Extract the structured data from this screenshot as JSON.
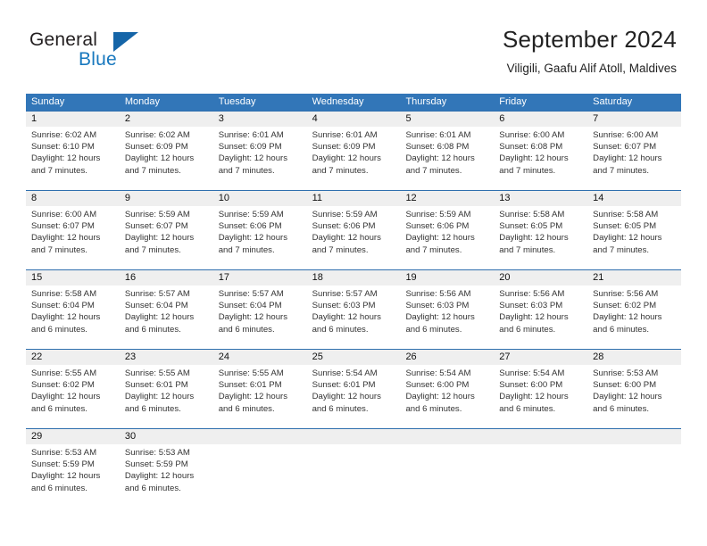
{
  "brand": {
    "name_part1": "General",
    "name_part2": "Blue",
    "logo_icon": "triangle-logo-icon",
    "accent_color": "#1565a8"
  },
  "header": {
    "title": "September 2024",
    "location": "Viligili, Gaafu Alif Atoll, Maldives"
  },
  "theme": {
    "header_band_color": "#3276b8",
    "row_rule_color": "#2f6fae",
    "day_strip_color": "#efefef",
    "text_color": "#333333"
  },
  "weekdays": [
    "Sunday",
    "Monday",
    "Tuesday",
    "Wednesday",
    "Thursday",
    "Friday",
    "Saturday"
  ],
  "weeks": [
    [
      {
        "day": "1",
        "sunrise": "Sunrise: 6:02 AM",
        "sunset": "Sunset: 6:10 PM",
        "daylight1": "Daylight: 12 hours",
        "daylight2": "and 7 minutes."
      },
      {
        "day": "2",
        "sunrise": "Sunrise: 6:02 AM",
        "sunset": "Sunset: 6:09 PM",
        "daylight1": "Daylight: 12 hours",
        "daylight2": "and 7 minutes."
      },
      {
        "day": "3",
        "sunrise": "Sunrise: 6:01 AM",
        "sunset": "Sunset: 6:09 PM",
        "daylight1": "Daylight: 12 hours",
        "daylight2": "and 7 minutes."
      },
      {
        "day": "4",
        "sunrise": "Sunrise: 6:01 AM",
        "sunset": "Sunset: 6:09 PM",
        "daylight1": "Daylight: 12 hours",
        "daylight2": "and 7 minutes."
      },
      {
        "day": "5",
        "sunrise": "Sunrise: 6:01 AM",
        "sunset": "Sunset: 6:08 PM",
        "daylight1": "Daylight: 12 hours",
        "daylight2": "and 7 minutes."
      },
      {
        "day": "6",
        "sunrise": "Sunrise: 6:00 AM",
        "sunset": "Sunset: 6:08 PM",
        "daylight1": "Daylight: 12 hours",
        "daylight2": "and 7 minutes."
      },
      {
        "day": "7",
        "sunrise": "Sunrise: 6:00 AM",
        "sunset": "Sunset: 6:07 PM",
        "daylight1": "Daylight: 12 hours",
        "daylight2": "and 7 minutes."
      }
    ],
    [
      {
        "day": "8",
        "sunrise": "Sunrise: 6:00 AM",
        "sunset": "Sunset: 6:07 PM",
        "daylight1": "Daylight: 12 hours",
        "daylight2": "and 7 minutes."
      },
      {
        "day": "9",
        "sunrise": "Sunrise: 5:59 AM",
        "sunset": "Sunset: 6:07 PM",
        "daylight1": "Daylight: 12 hours",
        "daylight2": "and 7 minutes."
      },
      {
        "day": "10",
        "sunrise": "Sunrise: 5:59 AM",
        "sunset": "Sunset: 6:06 PM",
        "daylight1": "Daylight: 12 hours",
        "daylight2": "and 7 minutes."
      },
      {
        "day": "11",
        "sunrise": "Sunrise: 5:59 AM",
        "sunset": "Sunset: 6:06 PM",
        "daylight1": "Daylight: 12 hours",
        "daylight2": "and 7 minutes."
      },
      {
        "day": "12",
        "sunrise": "Sunrise: 5:59 AM",
        "sunset": "Sunset: 6:06 PM",
        "daylight1": "Daylight: 12 hours",
        "daylight2": "and 7 minutes."
      },
      {
        "day": "13",
        "sunrise": "Sunrise: 5:58 AM",
        "sunset": "Sunset: 6:05 PM",
        "daylight1": "Daylight: 12 hours",
        "daylight2": "and 7 minutes."
      },
      {
        "day": "14",
        "sunrise": "Sunrise: 5:58 AM",
        "sunset": "Sunset: 6:05 PM",
        "daylight1": "Daylight: 12 hours",
        "daylight2": "and 7 minutes."
      }
    ],
    [
      {
        "day": "15",
        "sunrise": "Sunrise: 5:58 AM",
        "sunset": "Sunset: 6:04 PM",
        "daylight1": "Daylight: 12 hours",
        "daylight2": "and 6 minutes."
      },
      {
        "day": "16",
        "sunrise": "Sunrise: 5:57 AM",
        "sunset": "Sunset: 6:04 PM",
        "daylight1": "Daylight: 12 hours",
        "daylight2": "and 6 minutes."
      },
      {
        "day": "17",
        "sunrise": "Sunrise: 5:57 AM",
        "sunset": "Sunset: 6:04 PM",
        "daylight1": "Daylight: 12 hours",
        "daylight2": "and 6 minutes."
      },
      {
        "day": "18",
        "sunrise": "Sunrise: 5:57 AM",
        "sunset": "Sunset: 6:03 PM",
        "daylight1": "Daylight: 12 hours",
        "daylight2": "and 6 minutes."
      },
      {
        "day": "19",
        "sunrise": "Sunrise: 5:56 AM",
        "sunset": "Sunset: 6:03 PM",
        "daylight1": "Daylight: 12 hours",
        "daylight2": "and 6 minutes."
      },
      {
        "day": "20",
        "sunrise": "Sunrise: 5:56 AM",
        "sunset": "Sunset: 6:03 PM",
        "daylight1": "Daylight: 12 hours",
        "daylight2": "and 6 minutes."
      },
      {
        "day": "21",
        "sunrise": "Sunrise: 5:56 AM",
        "sunset": "Sunset: 6:02 PM",
        "daylight1": "Daylight: 12 hours",
        "daylight2": "and 6 minutes."
      }
    ],
    [
      {
        "day": "22",
        "sunrise": "Sunrise: 5:55 AM",
        "sunset": "Sunset: 6:02 PM",
        "daylight1": "Daylight: 12 hours",
        "daylight2": "and 6 minutes."
      },
      {
        "day": "23",
        "sunrise": "Sunrise: 5:55 AM",
        "sunset": "Sunset: 6:01 PM",
        "daylight1": "Daylight: 12 hours",
        "daylight2": "and 6 minutes."
      },
      {
        "day": "24",
        "sunrise": "Sunrise: 5:55 AM",
        "sunset": "Sunset: 6:01 PM",
        "daylight1": "Daylight: 12 hours",
        "daylight2": "and 6 minutes."
      },
      {
        "day": "25",
        "sunrise": "Sunrise: 5:54 AM",
        "sunset": "Sunset: 6:01 PM",
        "daylight1": "Daylight: 12 hours",
        "daylight2": "and 6 minutes."
      },
      {
        "day": "26",
        "sunrise": "Sunrise: 5:54 AM",
        "sunset": "Sunset: 6:00 PM",
        "daylight1": "Daylight: 12 hours",
        "daylight2": "and 6 minutes."
      },
      {
        "day": "27",
        "sunrise": "Sunrise: 5:54 AM",
        "sunset": "Sunset: 6:00 PM",
        "daylight1": "Daylight: 12 hours",
        "daylight2": "and 6 minutes."
      },
      {
        "day": "28",
        "sunrise": "Sunrise: 5:53 AM",
        "sunset": "Sunset: 6:00 PM",
        "daylight1": "Daylight: 12 hours",
        "daylight2": "and 6 minutes."
      }
    ],
    [
      {
        "day": "29",
        "sunrise": "Sunrise: 5:53 AM",
        "sunset": "Sunset: 5:59 PM",
        "daylight1": "Daylight: 12 hours",
        "daylight2": "and 6 minutes."
      },
      {
        "day": "30",
        "sunrise": "Sunrise: 5:53 AM",
        "sunset": "Sunset: 5:59 PM",
        "daylight1": "Daylight: 12 hours",
        "daylight2": "and 6 minutes."
      },
      {
        "day": "",
        "sunrise": "",
        "sunset": "",
        "daylight1": "",
        "daylight2": ""
      },
      {
        "day": "",
        "sunrise": "",
        "sunset": "",
        "daylight1": "",
        "daylight2": ""
      },
      {
        "day": "",
        "sunrise": "",
        "sunset": "",
        "daylight1": "",
        "daylight2": ""
      },
      {
        "day": "",
        "sunrise": "",
        "sunset": "",
        "daylight1": "",
        "daylight2": ""
      },
      {
        "day": "",
        "sunrise": "",
        "sunset": "",
        "daylight1": "",
        "daylight2": ""
      }
    ]
  ]
}
